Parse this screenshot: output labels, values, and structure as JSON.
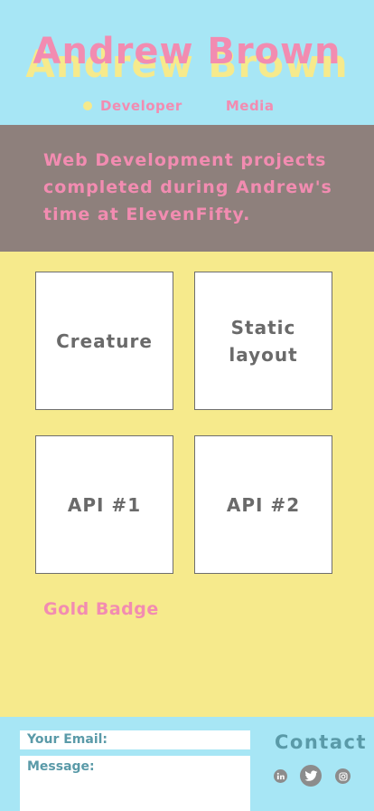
{
  "header": {
    "title": "Andrew Brown",
    "nav": [
      {
        "label": "Developer"
      },
      {
        "label": "Media"
      }
    ]
  },
  "intro": {
    "text": "Web Development projects completed during Andrew's time at ElevenFifty."
  },
  "projects": [
    {
      "label": "Creature"
    },
    {
      "label": "Static layout"
    },
    {
      "label": "API #1"
    },
    {
      "label": "API #2"
    }
  ],
  "badge": {
    "label": "Gold Badge"
  },
  "footer": {
    "email_label": "Your Email:",
    "message_label": "Message:",
    "contact_label": "Contact",
    "social_icons": [
      "linkedin-icon",
      "twitter-icon",
      "instagram-icon"
    ]
  },
  "colors": {
    "sky": "#a7e6f5",
    "pink": "#f28cb1",
    "yellow": "#f6ea8c",
    "taupe": "#8e807c",
    "teal_text": "#5a9aa8"
  }
}
